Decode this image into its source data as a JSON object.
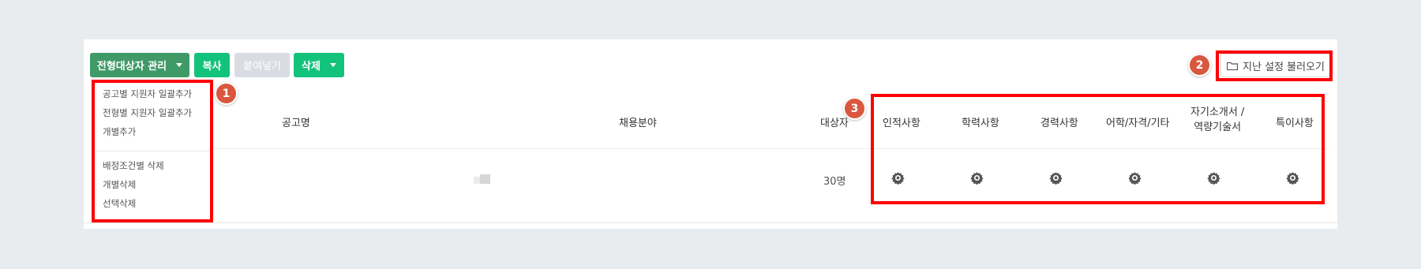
{
  "toolbar": {
    "manage_label": "전형대상자 관리",
    "copy_label": "복사",
    "paste_label": "붙여넣기",
    "delete_label": "삭제",
    "load_settings_label": "지난 설정 불러오기"
  },
  "dropdown": {
    "items": [
      "공고별 지원자 일괄추가",
      "전형별 지원자 일괄추가",
      "개별추가",
      "배정조건별 삭제",
      "개별삭제",
      "선택삭제"
    ]
  },
  "table": {
    "headers": {
      "notice": "공고명",
      "field": "채용분야",
      "target": "대상자",
      "personal": "인적사항",
      "education": "학력사항",
      "career": "경력사항",
      "language": "어학/자격/기타",
      "cover_letter_1": "자기소개서 /",
      "cover_letter_2": "역량기술서",
      "special": "특이사항"
    },
    "rows": [
      {
        "target_count": "30명"
      }
    ]
  },
  "badges": {
    "one": "1",
    "two": "2",
    "three": "3"
  },
  "colors": {
    "primary_dark": "#3f9a67",
    "primary": "#13c27b",
    "disabled": "#d9dce3",
    "highlight": "#ff0000",
    "badge": "#d9573f"
  }
}
